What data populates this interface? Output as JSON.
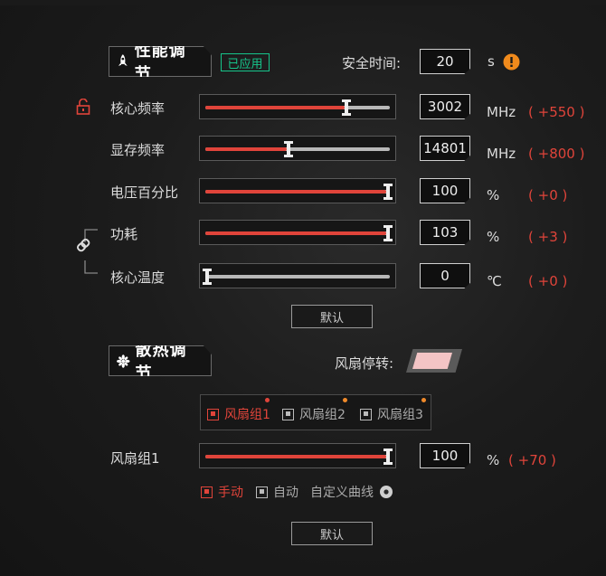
{
  "performance": {
    "title": "性能调节",
    "status": "已应用",
    "safe_time_label": "安全时间:",
    "safe_time_value": "20",
    "safe_time_unit": "s",
    "rows": [
      {
        "label": "核心频率",
        "value": "3002",
        "unit": "MHz",
        "delta": "( +550 )",
        "level": 0.77
      },
      {
        "label": "显存频率",
        "value": "14801",
        "unit": "MHz",
        "delta": "( +800 )",
        "level": 0.45
      },
      {
        "label": "电压百分比",
        "value": "100",
        "unit": "%",
        "delta": "( +0 )",
        "level": 1.0
      },
      {
        "label": "功耗",
        "value": "103",
        "unit": "%",
        "delta": "( +3 )",
        "level": 1.0
      },
      {
        "label": "核心温度",
        "value": "0",
        "unit": "℃",
        "delta": "( +0 )",
        "level": 0.0
      }
    ],
    "default_label": "默认"
  },
  "cooling": {
    "title": "散热调节",
    "fan_stop_label": "风扇停转:",
    "fan_stop_color": "#f3c4c5",
    "tabs": [
      {
        "label": "风扇组1",
        "dot_color": "#e0443a"
      },
      {
        "label": "风扇组2",
        "dot_color": "#f08a2a"
      },
      {
        "label": "风扇组3",
        "dot_color": "#f08a2a"
      }
    ],
    "fan_row": {
      "label": "风扇组1",
      "value": "100",
      "unit": "%",
      "delta": "( +70 )",
      "level": 1.0
    },
    "modes": {
      "manual": "手动",
      "auto": "自动",
      "custom": "自定义曲线"
    },
    "default_label": "默认"
  },
  "colors": {
    "accent": "#e0443a",
    "applied": "#16c58b",
    "warning": "#f08a1c"
  }
}
